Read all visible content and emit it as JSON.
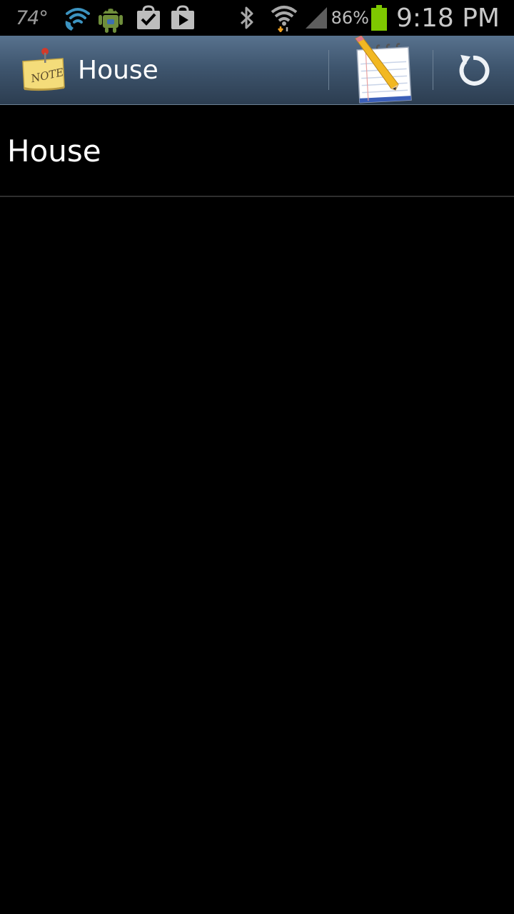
{
  "status_bar": {
    "temperature": "74°",
    "battery_percent": "86%",
    "time": "9:18 PM",
    "icons": [
      "wifi-calling-icon",
      "android-robot-icon",
      "task-check-icon",
      "play-store-icon",
      "bluetooth-icon",
      "wifi-download-icon",
      "cell-signal-icon",
      "battery-icon"
    ]
  },
  "action_bar": {
    "title": "House",
    "app_icon": "note-icon",
    "actions": [
      {
        "name": "edit-note-button",
        "icon": "notepad-pencil-icon"
      },
      {
        "name": "refresh-button",
        "icon": "refresh-icon"
      }
    ]
  },
  "list": {
    "items": [
      {
        "label": "House"
      }
    ]
  },
  "colors": {
    "background": "#000000",
    "action_bar_top": "#58728e",
    "action_bar_bottom": "#2c3d50",
    "battery_fill": "#7ec800",
    "divider": "#2f2f2f"
  }
}
